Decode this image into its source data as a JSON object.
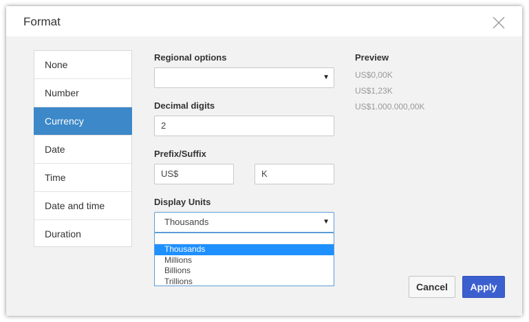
{
  "dialog": {
    "title": "Format"
  },
  "categories": [
    {
      "label": "None",
      "selected": false
    },
    {
      "label": "Number",
      "selected": false
    },
    {
      "label": "Currency",
      "selected": true
    },
    {
      "label": "Date",
      "selected": false
    },
    {
      "label": "Time",
      "selected": false
    },
    {
      "label": "Date and time",
      "selected": false
    },
    {
      "label": "Duration",
      "selected": false
    }
  ],
  "regional_options": {
    "label": "Regional options",
    "value": ""
  },
  "decimal_digits": {
    "label": "Decimal digits",
    "value": "2"
  },
  "prefix_suffix": {
    "label": "Prefix/Suffix",
    "prefix": "US$",
    "suffix": "K"
  },
  "display_units": {
    "label": "Display Units",
    "value": "Thousands",
    "options": [
      "Thousands",
      "Millions",
      "Billions",
      "Trillions"
    ],
    "highlighted": "Thousands"
  },
  "preview": {
    "label": "Preview",
    "lines": [
      "US$0,00K",
      "US$1,23K",
      "US$1.000.000,00K"
    ]
  },
  "buttons": {
    "cancel": "Cancel",
    "apply": "Apply"
  },
  "colors": {
    "selected_category": "#3c88c8",
    "apply_button": "#3c5fd0",
    "dropdown_highlight": "#1e90ff",
    "focus_border": "#5b9bd5"
  },
  "icons": {
    "close": "close-icon",
    "select_arrow": "caret-down-icon"
  }
}
